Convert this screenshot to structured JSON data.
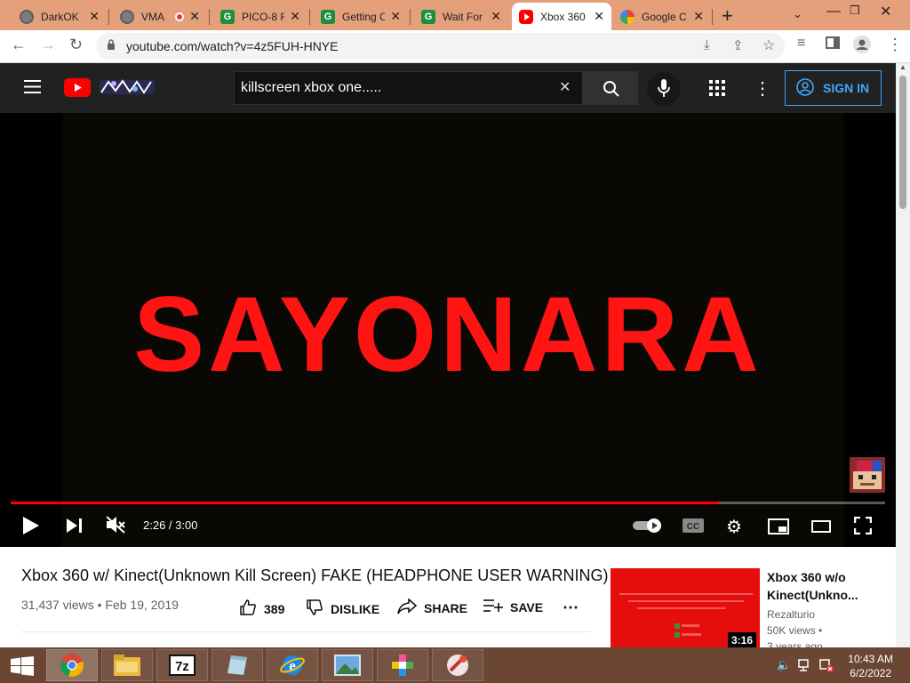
{
  "browser": {
    "tabs": [
      {
        "title": "DarkOK",
        "icon": "globe-icon",
        "active": false
      },
      {
        "title": "VMA",
        "icon": "globe-icon",
        "active": false,
        "recording": true
      },
      {
        "title": "PICO-8 F",
        "icon": "g-icon",
        "active": false
      },
      {
        "title": "Getting C",
        "icon": "g-icon",
        "active": false
      },
      {
        "title": "Wait For",
        "icon": "g-icon",
        "active": false
      },
      {
        "title": "Xbox 360",
        "icon": "youtube-icon",
        "active": true
      },
      {
        "title": "Google C",
        "icon": "google-icon",
        "active": false
      }
    ],
    "url": "youtube.com/watch?v=4z5FUH-HNYE",
    "tabstrip_color": "#e4a07a"
  },
  "youtube": {
    "search_value": "killscreen xbox one.....",
    "sign_in_label": "SIGN IN",
    "accent": "#3ea6ff"
  },
  "player": {
    "overlay_text": "SAYONARA",
    "overlay_color": "#ff1414",
    "time_current": "2:26",
    "time_total": "3:00",
    "time_display": "2:26 / 3:00",
    "progress_fraction": 0.81
  },
  "video": {
    "title": "Xbox 360 w/ Kinect(Unknown Kill Screen) FAKE (HEADPHONE USER WARNING)",
    "meta": "31,437 views • Feb 19, 2019",
    "likes": "389",
    "dislike_label": "DISLIKE",
    "share_label": "SHARE",
    "save_label": "SAVE"
  },
  "recommended": {
    "title_line1": "Xbox 360 w/o",
    "title_line2": "Kinect(Unkno...",
    "channel": "Rezalturio",
    "views": "50K views •",
    "age": "3 years ago",
    "duration": "3:16"
  },
  "taskbar": {
    "time": "10:43 AM",
    "date": "6/2/2022"
  }
}
